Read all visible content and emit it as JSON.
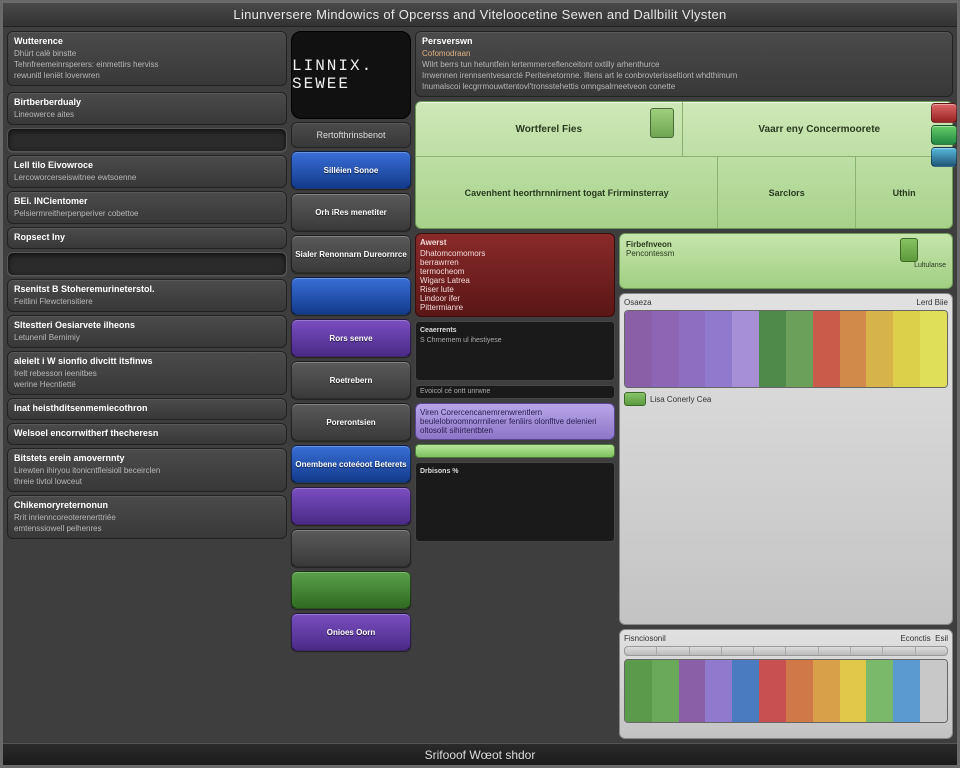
{
  "title": "Linunversere Mindowics of Opcerss and Viteloocetine Sewen and Dallbilit Vlysten",
  "status": "Srifooof Wœot shdor",
  "logo": "LINNIX. SEWEE",
  "left": {
    "intro": {
      "hd": "Wutterence",
      "l1": "Dhürt calë binstte",
      "l2": "Tehnfreemeinrsperers: einmettirs herviss",
      "l3": "rewunitl leniët loverwren"
    },
    "cards": [
      {
        "hd": "Birtberberdualy",
        "l1": "Lineowerce aites"
      },
      {
        "hd": "Lell tilo Eivowroce",
        "l1": "Lercoworcerseiswitnee ewtsoenne"
      },
      {
        "hd": "BEi. INCientomer",
        "l1": "Pelsiermreitherpenperiver cobettoe"
      },
      {
        "hd": "Ropsect Iny"
      },
      {
        "hd": "Rsenitst B Stoheremurineterstol.",
        "l1": "Feitlini Flewctensitiere"
      },
      {
        "hd": "Sltestteri Oesiarvete ilheons",
        "l1": "Letunenil Bernimiy"
      },
      {
        "hd": "aleielt i W sionfio divcitt itsfinws",
        "l1": "Irelt rebesson ieenitbes",
        "l2": "werine Hecntiettë"
      },
      {
        "hd": "Inat heisthditsenmemiecothron"
      },
      {
        "hd": "Welsoel encorrwitherf thecheresn"
      },
      {
        "hd": "Bitstets erein amovernnty",
        "l1": "Lirewten ihiryou itonicntfleisioll beceirclen",
        "l2": "threie tivtol lowceut"
      },
      {
        "hd": "Chikemoryreternonun",
        "l1": "Rrit inrienncoreoterenerttriée",
        "l2": "emtenssiowell pelhenres"
      }
    ]
  },
  "mid": {
    "top_label": "Rertofthrinsbenot",
    "items": [
      {
        "cls": "blue",
        "txt": "Silléien Sonoe"
      },
      {
        "cls": "gray",
        "txt": "Orh iRes menetiter"
      },
      {
        "cls": "gray",
        "txt": "Sialer Renonnarn Dureornrce"
      },
      {
        "cls": "blue",
        "txt": ""
      },
      {
        "cls": "purple",
        "txt": "Rors senve"
      },
      {
        "cls": "gray",
        "txt": "Roetrebern"
      },
      {
        "cls": "gray",
        "txt": "Porerontsien"
      },
      {
        "cls": "blue",
        "txt": "Onembene coteéoot Beterets"
      },
      {
        "cls": "purple",
        "txt": ""
      },
      {
        "cls": "gray",
        "txt": ""
      },
      {
        "cls": "green",
        "txt": ""
      },
      {
        "cls": "purple",
        "txt": "Onioes Oorn"
      }
    ]
  },
  "right": {
    "info": {
      "hd": "Persverswn",
      "b0": "Cofomodraan",
      "b1": "Wilrt berrs tun hetuntfein lertemmerceflenceitont oxtilly arhenthurce",
      "b2": "Irrwennen irennsentvesarcté Periteinetornne. Illens art le conbrovterisseltiont whdthimurn",
      "b3": "Inumalscoi lecgrrmouwttentovl'tronsstehettis omngsalrneetveon conette"
    },
    "green": {
      "row1": [
        "Wortferel Fies",
        "Vaarr eny Concermoorete"
      ],
      "row2": [
        "Cavenhent heorthrnnirnent togat Frirminsterray",
        "Sarclors",
        "Uthin"
      ]
    },
    "gp2": {
      "hd": "Firbefnveon",
      "l1": "Pencontessm",
      "l2": "Lultulanse"
    },
    "red": {
      "hd": "Awerst",
      "lines": [
        "Dhatomcomomors",
        "berrawrren",
        "termocheom",
        "Wigars Latrea",
        "Riser lute",
        "Lindoor ifer",
        "Pittermianre"
      ]
    },
    "dark1": {
      "hd": "Ceaerrents",
      "sub": "S Chrnemem ul ihestiyese"
    },
    "purple": {
      "txt": "Viren Corercencanemrenwrentlern beulelobroomnorrnilener fenliirs olonfltve delenieri oltosolit sihirtentbten"
    },
    "darkbar": "Evoicol cé ontt unrwne",
    "dark2": {
      "hd": "Drbisons %"
    },
    "panel_top": {
      "hd": "Osaeza",
      "r": "Lerd Biie"
    },
    "legend": "Lisa Conerly Cea",
    "panel_bot": {
      "hd": "Fisnciosonil",
      "r1": "Econctis",
      "r2": "Esil"
    },
    "spectrum": [
      "#8a5fa8",
      "#8c66b4",
      "#8e6ec0",
      "#907ace",
      "#a68fd6",
      "#4f8a4a",
      "#6aa05a",
      "#ca5a4a",
      "#d08a4a",
      "#d6b44a",
      "#dcd04a",
      "#e0e058"
    ],
    "spectrum2": [
      "#5a9a4a",
      "#6aa85a",
      "#8a5fa8",
      "#907ace",
      "#4a7ac0",
      "#c85050",
      "#d07848",
      "#d8a048",
      "#e0c848",
      "#7ab86a",
      "#5a9ad0",
      "#c8c8c8"
    ]
  }
}
